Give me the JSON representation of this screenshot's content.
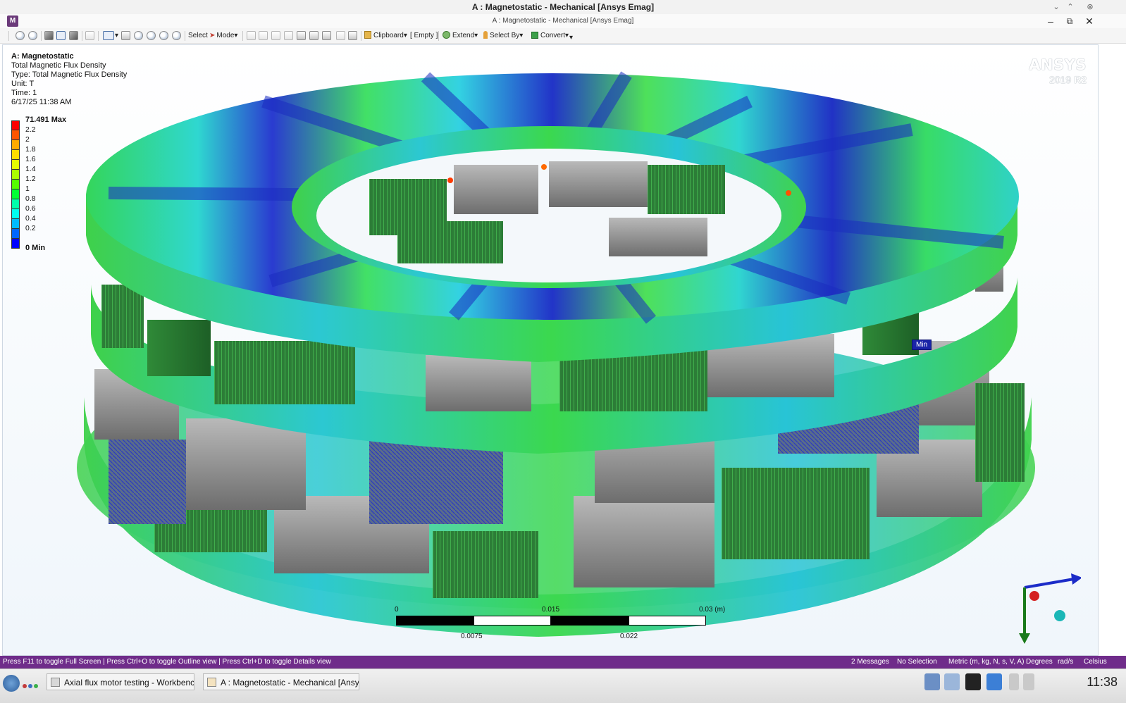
{
  "window": {
    "title": "A : Magnetostatic - Mechanical [Ansys Emag]",
    "subtitle": "A : Magnetostatic - Mechanical [Ansys Emag]",
    "app_icon_letter": "M",
    "ctrl_down": "⌄",
    "ctrl_up": "⌃",
    "ctrl_close": "⊗",
    "minimize": "–",
    "restore": "⧉",
    "close": "✕"
  },
  "toolbar": {
    "select_label": "Select",
    "mode_label": "Mode",
    "clipboard_label": "Clipboard",
    "empty_label": "[ Empty ]",
    "extend_label": "Extend",
    "select_by_label": "Select By",
    "convert_label": "Convert",
    "dropdown_arrow": "▾",
    "overflow_arrow": "▾"
  },
  "result": {
    "analysis": "A: Magnetostatic",
    "name": "Total Magnetic Flux Density",
    "type": "Type: Total Magnetic Flux Density",
    "unit": "Unit: T",
    "time": "Time: 1",
    "date": "6/17/25 11:38 AM",
    "legend": [
      {
        "label": "71.491 Max",
        "color": "#ff0000",
        "bold": true
      },
      {
        "label": "2.2",
        "color": "#ff5500"
      },
      {
        "label": "2",
        "color": "#ffaa00"
      },
      {
        "label": "1.8",
        "color": "#ffdd00"
      },
      {
        "label": "1.6",
        "color": "#e5ff00"
      },
      {
        "label": "1.4",
        "color": "#aaff00"
      },
      {
        "label": "1.2",
        "color": "#55ff00"
      },
      {
        "label": "1",
        "color": "#00ff33"
      },
      {
        "label": "0.8",
        "color": "#00ffaa"
      },
      {
        "label": "0.6",
        "color": "#00ffee"
      },
      {
        "label": "0.4",
        "color": "#00bbff"
      },
      {
        "label": "0.2",
        "color": "#0066ff"
      }
    ],
    "legend_min": "0 Min",
    "min_tag": "Min"
  },
  "logo": {
    "brand": "ANSYS",
    "version_year": "2019",
    "version_release": "R2"
  },
  "scale": {
    "t0": "0",
    "t1": "0.0075",
    "t2": "0.015",
    "t3": "0.022",
    "t4": "0.03 (m)"
  },
  "statusbar": {
    "hint": "Press F11 to toggle Full Screen | Press Ctrl+O to toggle Outline view | Press Ctrl+D to toggle Details view",
    "messages": "2 Messages",
    "selection": "No Selection",
    "units": "Metric (m, kg, N, s, V, A)",
    "angle": "Degrees",
    "angular_velocity": "rad/s",
    "temperature": "Celsius"
  },
  "taskbar": {
    "item1": "Axial flux motor testing - Workbench",
    "item2": "A : Magnetostatic - Mechanical [Ansys E",
    "clock": "11:38"
  },
  "colors": {
    "statusbar": "#6f2c8a",
    "viewport_bg": "#f0f6fb",
    "model_gray": "#8a8a8a",
    "field_green": "#3cd94a",
    "field_cyan": "#2fd6d0",
    "field_blue": "#1b22c8"
  }
}
